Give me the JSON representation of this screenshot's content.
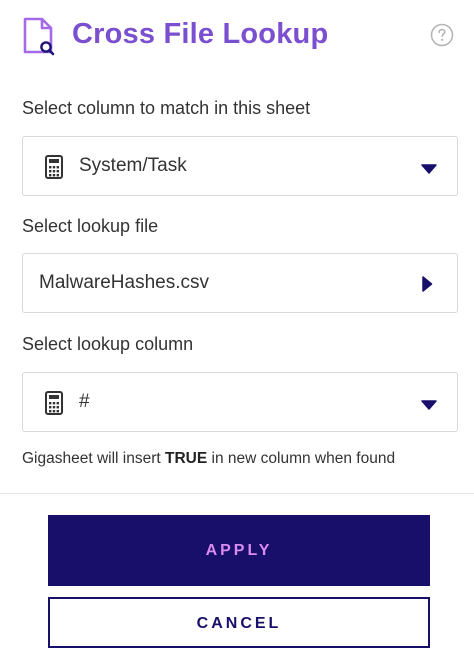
{
  "header": {
    "title": "Cross File Lookup",
    "title_color": "#7a4fd0",
    "icon": "file-search-icon",
    "help_icon": "help-circle-icon"
  },
  "fields": {
    "match_column": {
      "label": "Select column to match in this sheet",
      "value": "System/Task",
      "icon": "calculator-icon"
    },
    "lookup_file": {
      "label": "Select lookup file",
      "value": "MalwareHashes.csv"
    },
    "lookup_column": {
      "label": "Select lookup column",
      "value": "#",
      "icon": "calculator-icon"
    }
  },
  "note": {
    "prefix": "Gigasheet will insert ",
    "keyword": "TRUE",
    "suffix": " in new column when found"
  },
  "buttons": {
    "apply": "APPLY",
    "cancel": "CANCEL",
    "primary_color": "#180f6b",
    "apply_text_color": "#d98bf0"
  }
}
